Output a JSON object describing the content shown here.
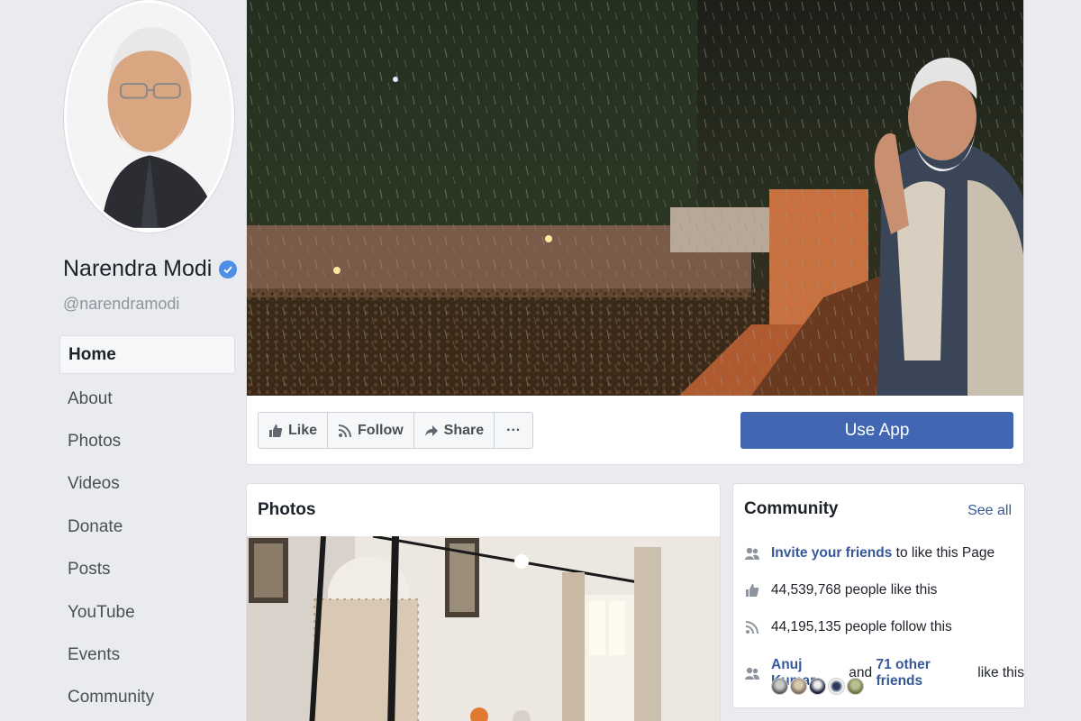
{
  "profile": {
    "name": "Narendra Modi",
    "handle": "@narendramodi",
    "verified_color": "#4d8ee8"
  },
  "nav": {
    "items": [
      {
        "label": "Home",
        "active": true
      },
      {
        "label": "About"
      },
      {
        "label": "Photos"
      },
      {
        "label": "Videos"
      },
      {
        "label": "Donate"
      },
      {
        "label": "Posts"
      },
      {
        "label": "YouTube"
      },
      {
        "label": "Events"
      },
      {
        "label": "Community"
      }
    ]
  },
  "actions": {
    "like": "Like",
    "follow": "Follow",
    "share": "Share",
    "more": "···",
    "use_app": "Use App"
  },
  "photos": {
    "title": "Photos"
  },
  "community": {
    "title": "Community",
    "see_all": "See all",
    "invite_link": "Invite your friends",
    "invite_rest": " to like this Page",
    "likes": "44,539,768 people like this",
    "follows": "44,195,135 people follow this",
    "friend_name": "Anuj Kumar",
    "and_text": " and ",
    "others_link": "71 other friends",
    "like_this": " like this"
  },
  "colors": {
    "brand_blue": "#4267b2",
    "link_blue": "#385898",
    "background": "#e9ebee"
  }
}
